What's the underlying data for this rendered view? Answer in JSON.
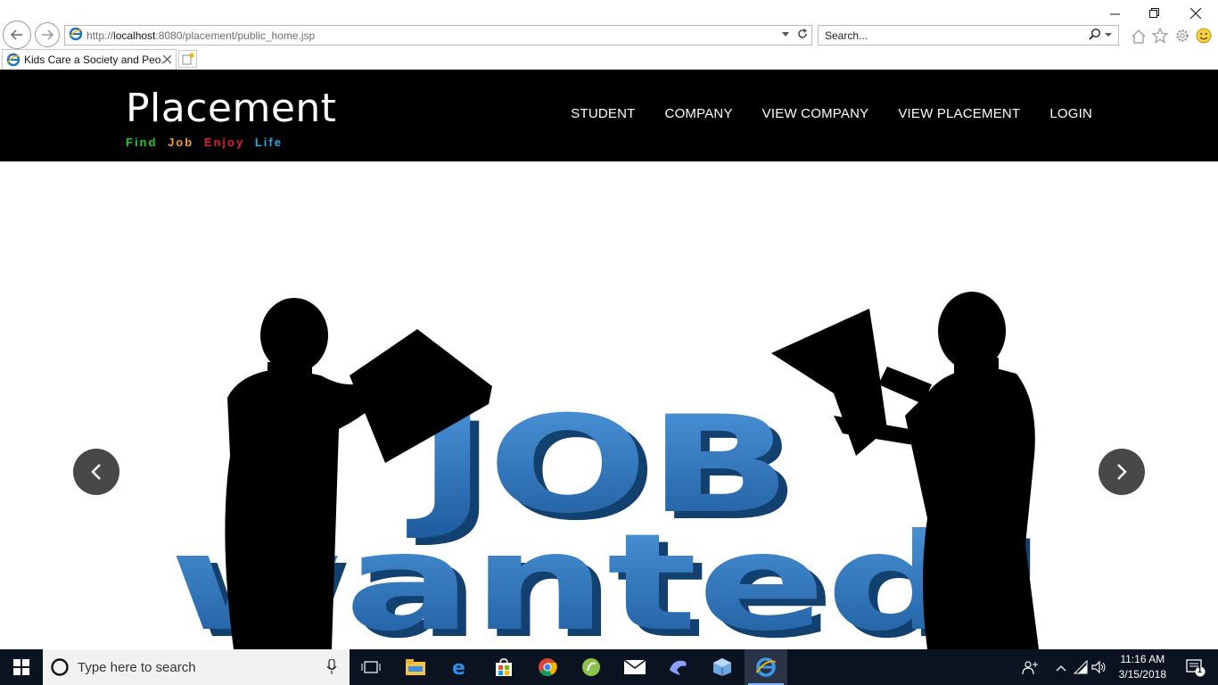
{
  "window": {
    "minimize_icon": "minimize-icon",
    "restore_icon": "restore-icon",
    "close_icon": "close-icon"
  },
  "toolbar": {
    "back_icon": "back-arrow-icon",
    "forward_icon": "forward-arrow-icon",
    "address_prefix": "http://",
    "address_host": "localhost",
    "address_rest": ":8080/placement/public_home.jsp",
    "search_placeholder": "Search...",
    "home_icon": "home-icon",
    "favorites_icon": "star-icon",
    "settings_icon": "gear-icon",
    "feedback_icon": "smiley-icon"
  },
  "tabs": [
    {
      "title": "Kids Care a Society and Peo..."
    }
  ],
  "site": {
    "brand": "Placement",
    "tagline": [
      {
        "text": "Find",
        "color": "#22cc33"
      },
      {
        "text": "Job",
        "color": "#f0a020"
      },
      {
        "text": "Enjoy",
        "color": "#e0203a"
      },
      {
        "text": "Life",
        "color": "#2aa8e0"
      }
    ],
    "nav": [
      "STUDENT",
      "COMPANY",
      "VIEW COMPANY",
      "VIEW PLACEMENT",
      "LOGIN"
    ]
  },
  "carousel": {
    "slide_word_1": "JOB",
    "slide_word_2": "wanted!",
    "prev_icon": "chevron-left-icon",
    "next_icon": "chevron-right-icon",
    "accent_color": "#2a72b8"
  },
  "taskbar": {
    "search_placeholder": "Type here to search",
    "time": "11:16 AM",
    "date": "3/15/2018",
    "notification_count": "1"
  }
}
